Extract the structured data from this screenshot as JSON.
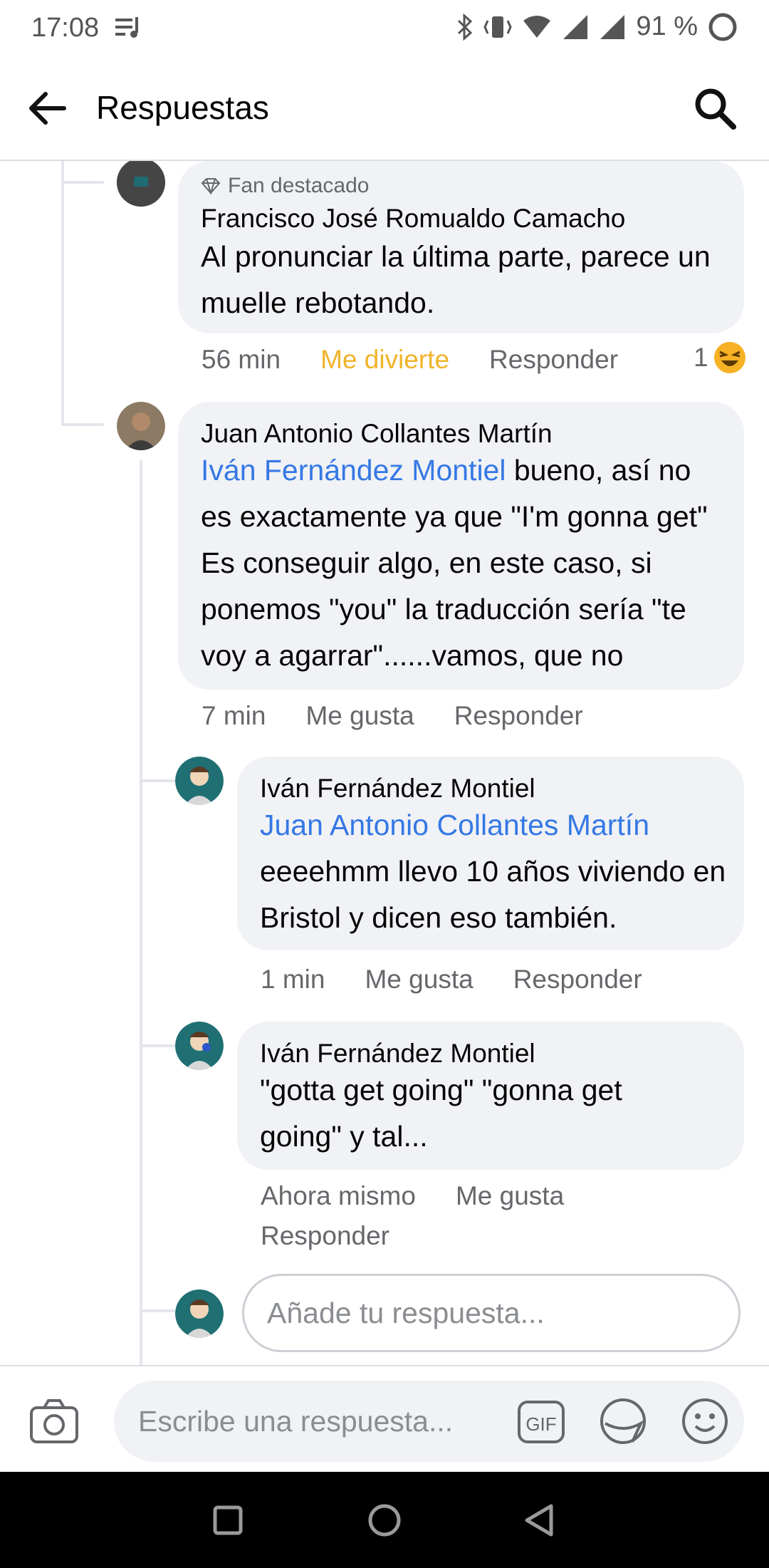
{
  "status_bar": {
    "time": "17:08",
    "battery": "91 %"
  },
  "header": {
    "title": "Respuestas"
  },
  "comments": [
    {
      "badge": "Fan destacado",
      "author": "Francisco José Romualdo Camacho",
      "text": "Al pronunciar la última parte, parece un muelle rebotando.",
      "time": "56 min",
      "reaction": "Me divierte",
      "reply": "Responder",
      "reaction_count": "1"
    },
    {
      "author": "Juan Antonio Collantes Martín",
      "mention": "Iván Fernández Montiel",
      "text": " bueno, así no es exactamente ya que \"I'm gonna get\" Es conseguir algo, en este caso, si ponemos \"you\" la traducción sería \"te voy a agarrar\"......vamos, que no",
      "time": "7 min",
      "like": "Me gusta",
      "reply": "Responder"
    },
    {
      "author": "Iván Fernández Montiel",
      "mention": "Juan Antonio Collantes Martín",
      "text": "eeeehmm llevo 10 años viviendo en Bristol y dicen eso también.",
      "time": "1 min",
      "like": "Me gusta",
      "reply": "Responder"
    },
    {
      "author": "Iván Fernández Montiel",
      "text": "\"gotta get going\" \"gonna get going\" y tal...",
      "time": "Ahora mismo",
      "like": "Me gusta",
      "reply": "Responder"
    }
  ],
  "reply_input": {
    "placeholder": "Añade tu respuesta..."
  },
  "composer": {
    "placeholder": "Escribe una respuesta...",
    "gif_label": "GIF"
  }
}
